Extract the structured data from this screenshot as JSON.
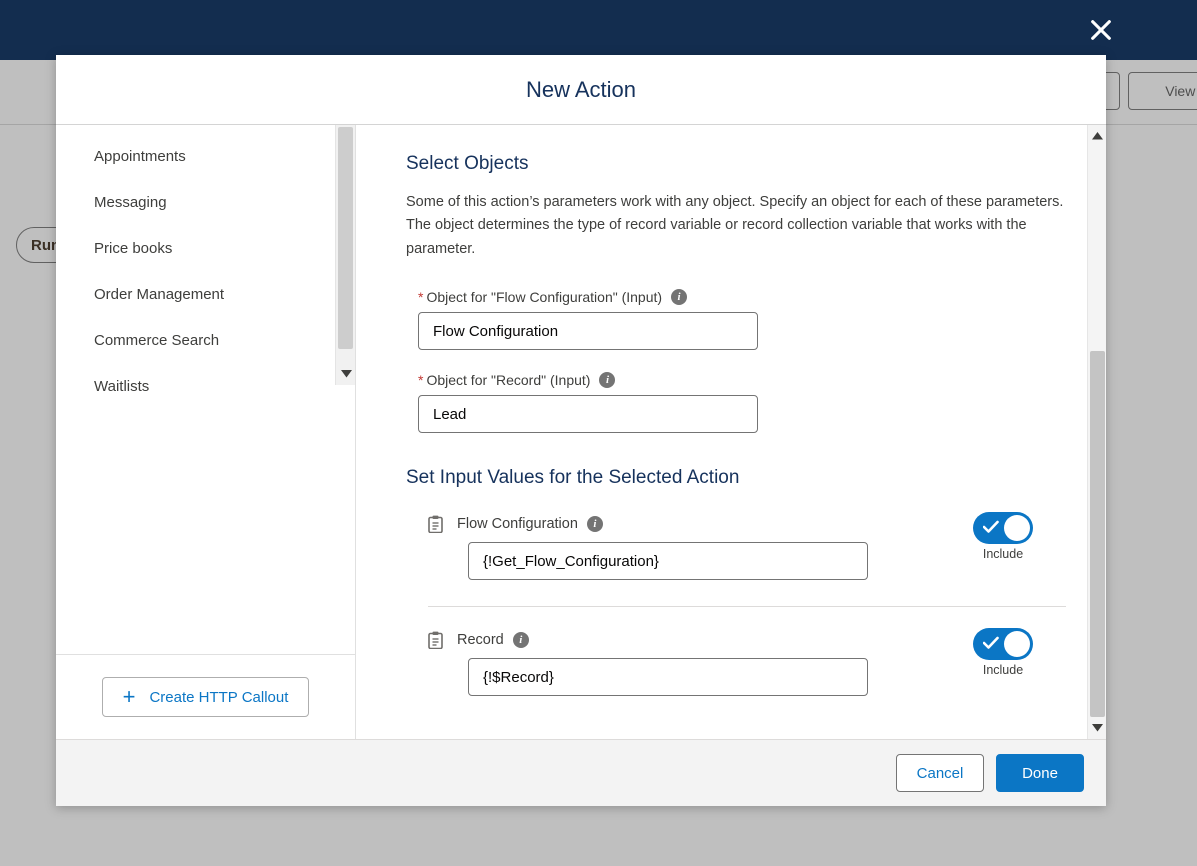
{
  "colors": {
    "top_bar": "#132D4F",
    "brand_blue": "#0b76c5",
    "title_navy": "#16325c",
    "required_red": "#c23934",
    "scrim": "#a9a9a9"
  },
  "background": {
    "run_button": "Run",
    "view_test_button": "View Tes",
    "edit_button": ""
  },
  "modal": {
    "title": "New Action",
    "close_icon": "close-icon"
  },
  "sidebar": {
    "items": [
      {
        "label": "Appointments"
      },
      {
        "label": "Messaging"
      },
      {
        "label": "Price books"
      },
      {
        "label": "Order Management"
      },
      {
        "label": "Commerce Search"
      },
      {
        "label": "Waitlists"
      }
    ],
    "create_http_callout_label": "Create HTTP Callout",
    "plus_icon": "plus-icon",
    "scroll_down_icon": "chevron-down-icon"
  },
  "main": {
    "select_objects_heading": "Select Objects",
    "select_objects_description": "Some of this action’s parameters work with any object. Specify an object for each of these parameters. The object determines the type of record variable or record collection variable that works with the parameter.",
    "object_fields": [
      {
        "label": "Object for \"Flow Configuration\" (Input)",
        "required": true,
        "required_marker": "*",
        "value": "Flow Configuration",
        "info_icon": "info-icon"
      },
      {
        "label": "Object for \"Record\" (Input)",
        "required": true,
        "required_marker": "*",
        "value": "Lead",
        "info_icon": "info-icon"
      }
    ],
    "set_input_heading": "Set Input Values for the Selected Action",
    "parameters": [
      {
        "name": "Flow Configuration",
        "value": "{!Get_Flow_Configuration}",
        "icon": "clipboard-record-icon",
        "info_icon": "info-icon",
        "toggle_label": "Include",
        "toggle_on": true
      },
      {
        "name": "Record",
        "value": "{!$Record}",
        "icon": "clipboard-record-icon",
        "info_icon": "info-icon",
        "toggle_label": "Include",
        "toggle_on": true
      }
    ],
    "scroll_up_icon": "chevron-up-icon",
    "scroll_down_icon": "chevron-down-icon"
  },
  "footer": {
    "cancel_label": "Cancel",
    "done_label": "Done"
  }
}
